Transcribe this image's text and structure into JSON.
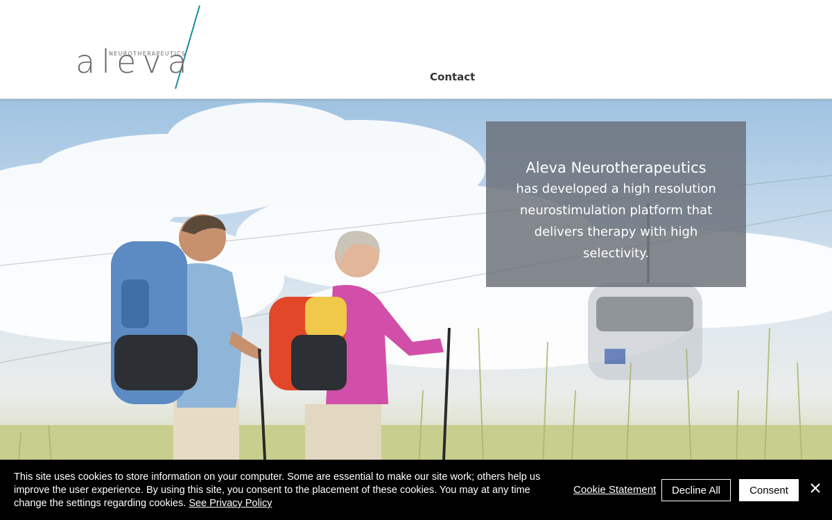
{
  "header": {
    "logo": {
      "word": "aleva",
      "tagline": "NEUROTHERAPEUTICS",
      "accent_color": "#1a8a9a"
    },
    "nav": {
      "contact_label": "Contact"
    }
  },
  "hero": {
    "title": "Aleva Neurotherapeutics",
    "body": "has developed a high resolution neurostimulation platform that delivers therapy with high selectivity."
  },
  "cookie_banner": {
    "message": "This site uses cookies to store information on your computer. Some are essential to make our site work; others help us improve the user experience. By using this site, you consent to the placement of these cookies. You may at any time change the settings regarding cookies.",
    "privacy_link": "See Privacy Policy",
    "statement_link": "Cookie Statement",
    "decline_label": "Decline All",
    "consent_label": "Consent",
    "close_icon": "close-icon"
  }
}
